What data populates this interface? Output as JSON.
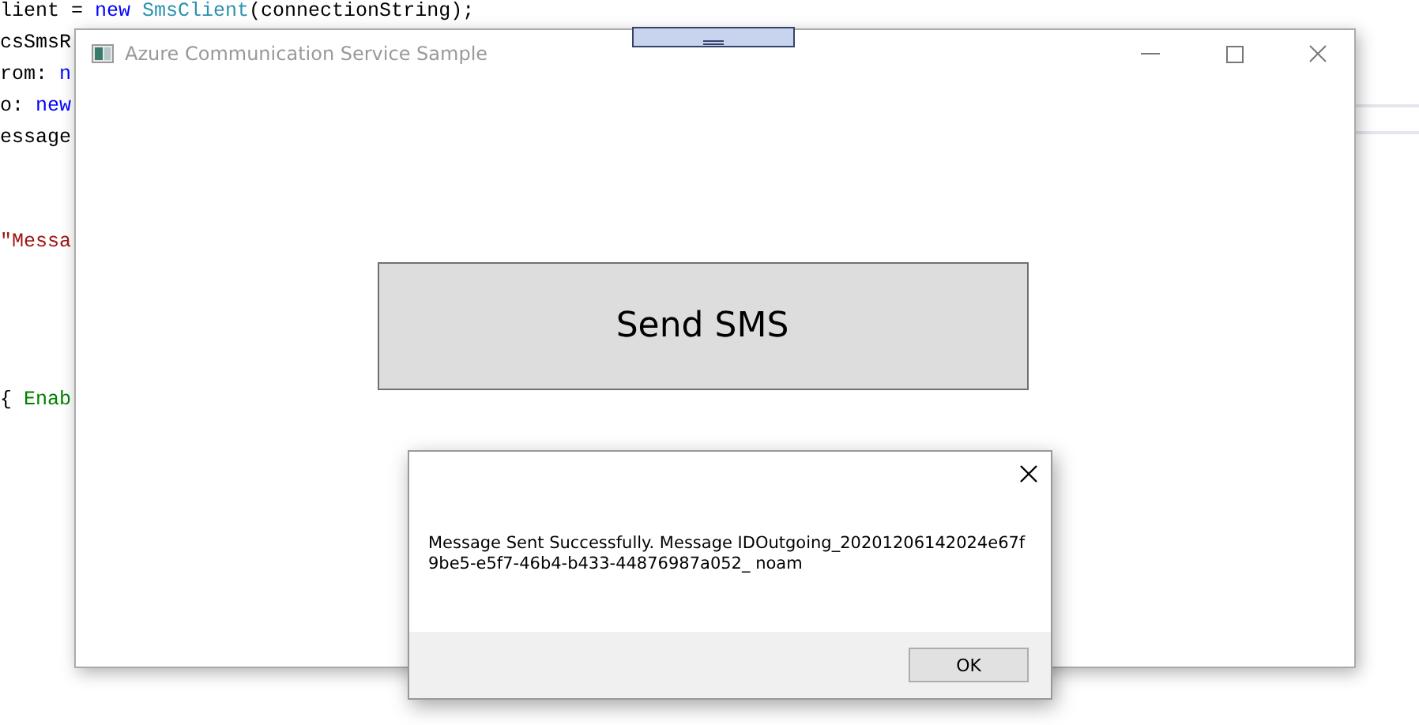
{
  "editor": {
    "lines": [
      {
        "spans": [
          {
            "kind": "plain",
            "text": "lient = "
          },
          {
            "kind": "keyword",
            "text": "new "
          },
          {
            "kind": "type",
            "text": "SmsClient"
          },
          {
            "kind": "plain",
            "text": "(connectionString);"
          }
        ]
      },
      {
        "spans": [
          {
            "kind": "plain",
            "text": "csSmsR"
          }
        ]
      },
      {
        "spans": [
          {
            "kind": "plain",
            "text": "rom: "
          },
          {
            "kind": "keyword",
            "text": "n"
          }
        ]
      },
      {
        "spans": [
          {
            "kind": "plain",
            "text": "o: "
          },
          {
            "kind": "keyword",
            "text": "new"
          }
        ]
      },
      {
        "spans": [
          {
            "kind": "plain",
            "text": "essage"
          }
        ]
      },
      {
        "spans": [
          {
            "kind": "string",
            "text": "\"Messa"
          }
        ]
      },
      {
        "spans": [
          {
            "kind": "plain",
            "text": "{ "
          },
          {
            "kind": "property",
            "text": "Enab"
          }
        ]
      }
    ]
  },
  "window": {
    "title": "Azure Communication Service Sample",
    "button": "Send SMS"
  },
  "dialog": {
    "message": "Message Sent Successfully. Message IDOutgoing_20201206142024e67f9be5-e5f7-46b4-b433-44876987a052_ noam",
    "button": "OK"
  }
}
